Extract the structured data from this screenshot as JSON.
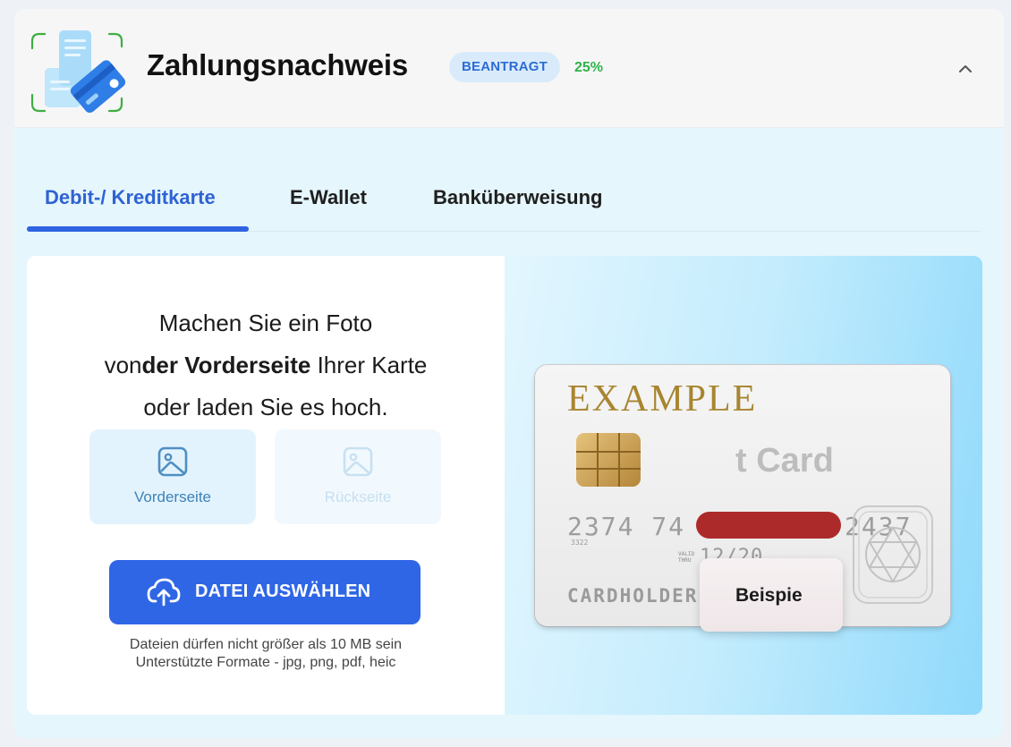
{
  "header": {
    "icon": "document-card-icon",
    "title": "Zahlungsnachweis",
    "status_badge": "BEANTRAGT",
    "progress_text": "25%",
    "progress": 0.25,
    "collapse_icon": "chevron-up-icon"
  },
  "tabs": [
    {
      "label": "Debit-/ Kreditkarte",
      "active": true
    },
    {
      "label": "E-Wallet",
      "active": false
    },
    {
      "label": "Banküberweisung",
      "active": false
    }
  ],
  "upload_panel": {
    "line1": "Machen Sie ein Foto",
    "line2_prefix": "von",
    "line2_bold": "der Vorderseite",
    "line2_suffix": " Ihrer Karte",
    "line3": "oder laden Sie es hoch.",
    "front_label": "Vorderseite",
    "back_label": "Rückseite",
    "side_icon": "image-icon",
    "upload_button_label": "DATEI AUSWÄHLEN",
    "upload_icon": "cloud-upload-icon",
    "note_size": "Dateien dürfen nicht größer als 10 MB sein",
    "note_formats": "Unterstützte Formate - jpg, png, pdf, heic"
  },
  "example_card": {
    "brand": "EXAMPLE",
    "card_type_partial": "t Card",
    "number_start": "2374 74",
    "number_end": "2437",
    "small_number": "3322",
    "valid_label_1": "VALID",
    "valid_label_2": "THRU",
    "valid_thru": "12/20",
    "holder": "CARDHOLDER NAME",
    "tooltip": "Beispie"
  },
  "colors": {
    "accent": "#2f66e6",
    "badge_bg": "#d9ebfb",
    "badge_text": "#2e6cd3",
    "progress_green": "#2fb349",
    "panel_bg": "#e5f6fd"
  }
}
